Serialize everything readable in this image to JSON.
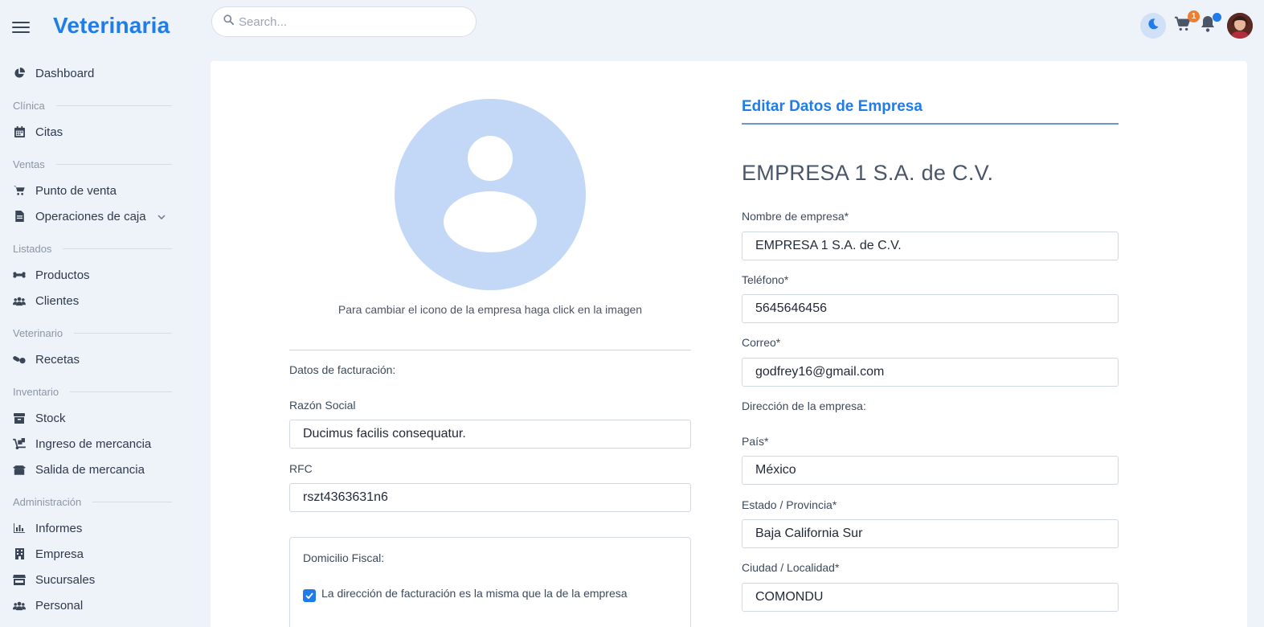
{
  "app": {
    "brand": "Veterinaria"
  },
  "search": {
    "placeholder": "Search..."
  },
  "topbar": {
    "cart_count": "1"
  },
  "sidebar": {
    "dashboard": "Dashboard",
    "clinica": {
      "heading": "Clínica",
      "items": [
        "Citas"
      ]
    },
    "ventas": {
      "heading": "Ventas",
      "items": [
        "Punto de venta",
        "Operaciones de caja"
      ]
    },
    "listados": {
      "heading": "Listados",
      "items": [
        "Productos",
        "Clientes"
      ]
    },
    "veterinario": {
      "heading": "Veterinario",
      "items": [
        "Recetas"
      ]
    },
    "inventario": {
      "heading": "Inventario",
      "items": [
        "Stock",
        "Ingreso de mercancia",
        "Salida de mercancia"
      ]
    },
    "administracion": {
      "heading": "Administración",
      "items": [
        "Informes",
        "Empresa",
        "Sucursales",
        "Personal"
      ]
    }
  },
  "left": {
    "avatar_hint": "Para cambiar el icono de la empresa haga click en la imagen",
    "billing_heading": "Datos de facturación:",
    "razon_label": "Razón Social",
    "razon_value": "Ducimus facilis consequatur.",
    "rfc_label": "RFC",
    "rfc_value": "rszt4363631n6",
    "domicilio_heading": "Domicilio Fiscal:",
    "same_address_label": "La dirección de facturación es la misma que la de la empresa",
    "same_address_checked": true
  },
  "right": {
    "title": "Editar Datos de Empresa",
    "company_name": "EMPRESA 1 S.A. de C.V.",
    "nombre_label": "Nombre de empresa*",
    "nombre_value": "EMPRESA 1 S.A. de C.V.",
    "telefono_label": "Teléfono*",
    "telefono_value": "5645646456",
    "correo_label": "Correo*",
    "correo_value": "godfrey16@gmail.com",
    "direccion_heading": "Dirección de la empresa:",
    "pais_label": "País*",
    "pais_value": "México",
    "estado_label": "Estado / Provincia*",
    "estado_value": "Baja California Sur",
    "ciudad_label": "Ciudad / Localidad*",
    "ciudad_value": "COMONDU"
  },
  "colors": {
    "accent": "#1f7ce8",
    "avatar_placeholder": "#c3d8f6",
    "badge": "#f07c2e"
  }
}
